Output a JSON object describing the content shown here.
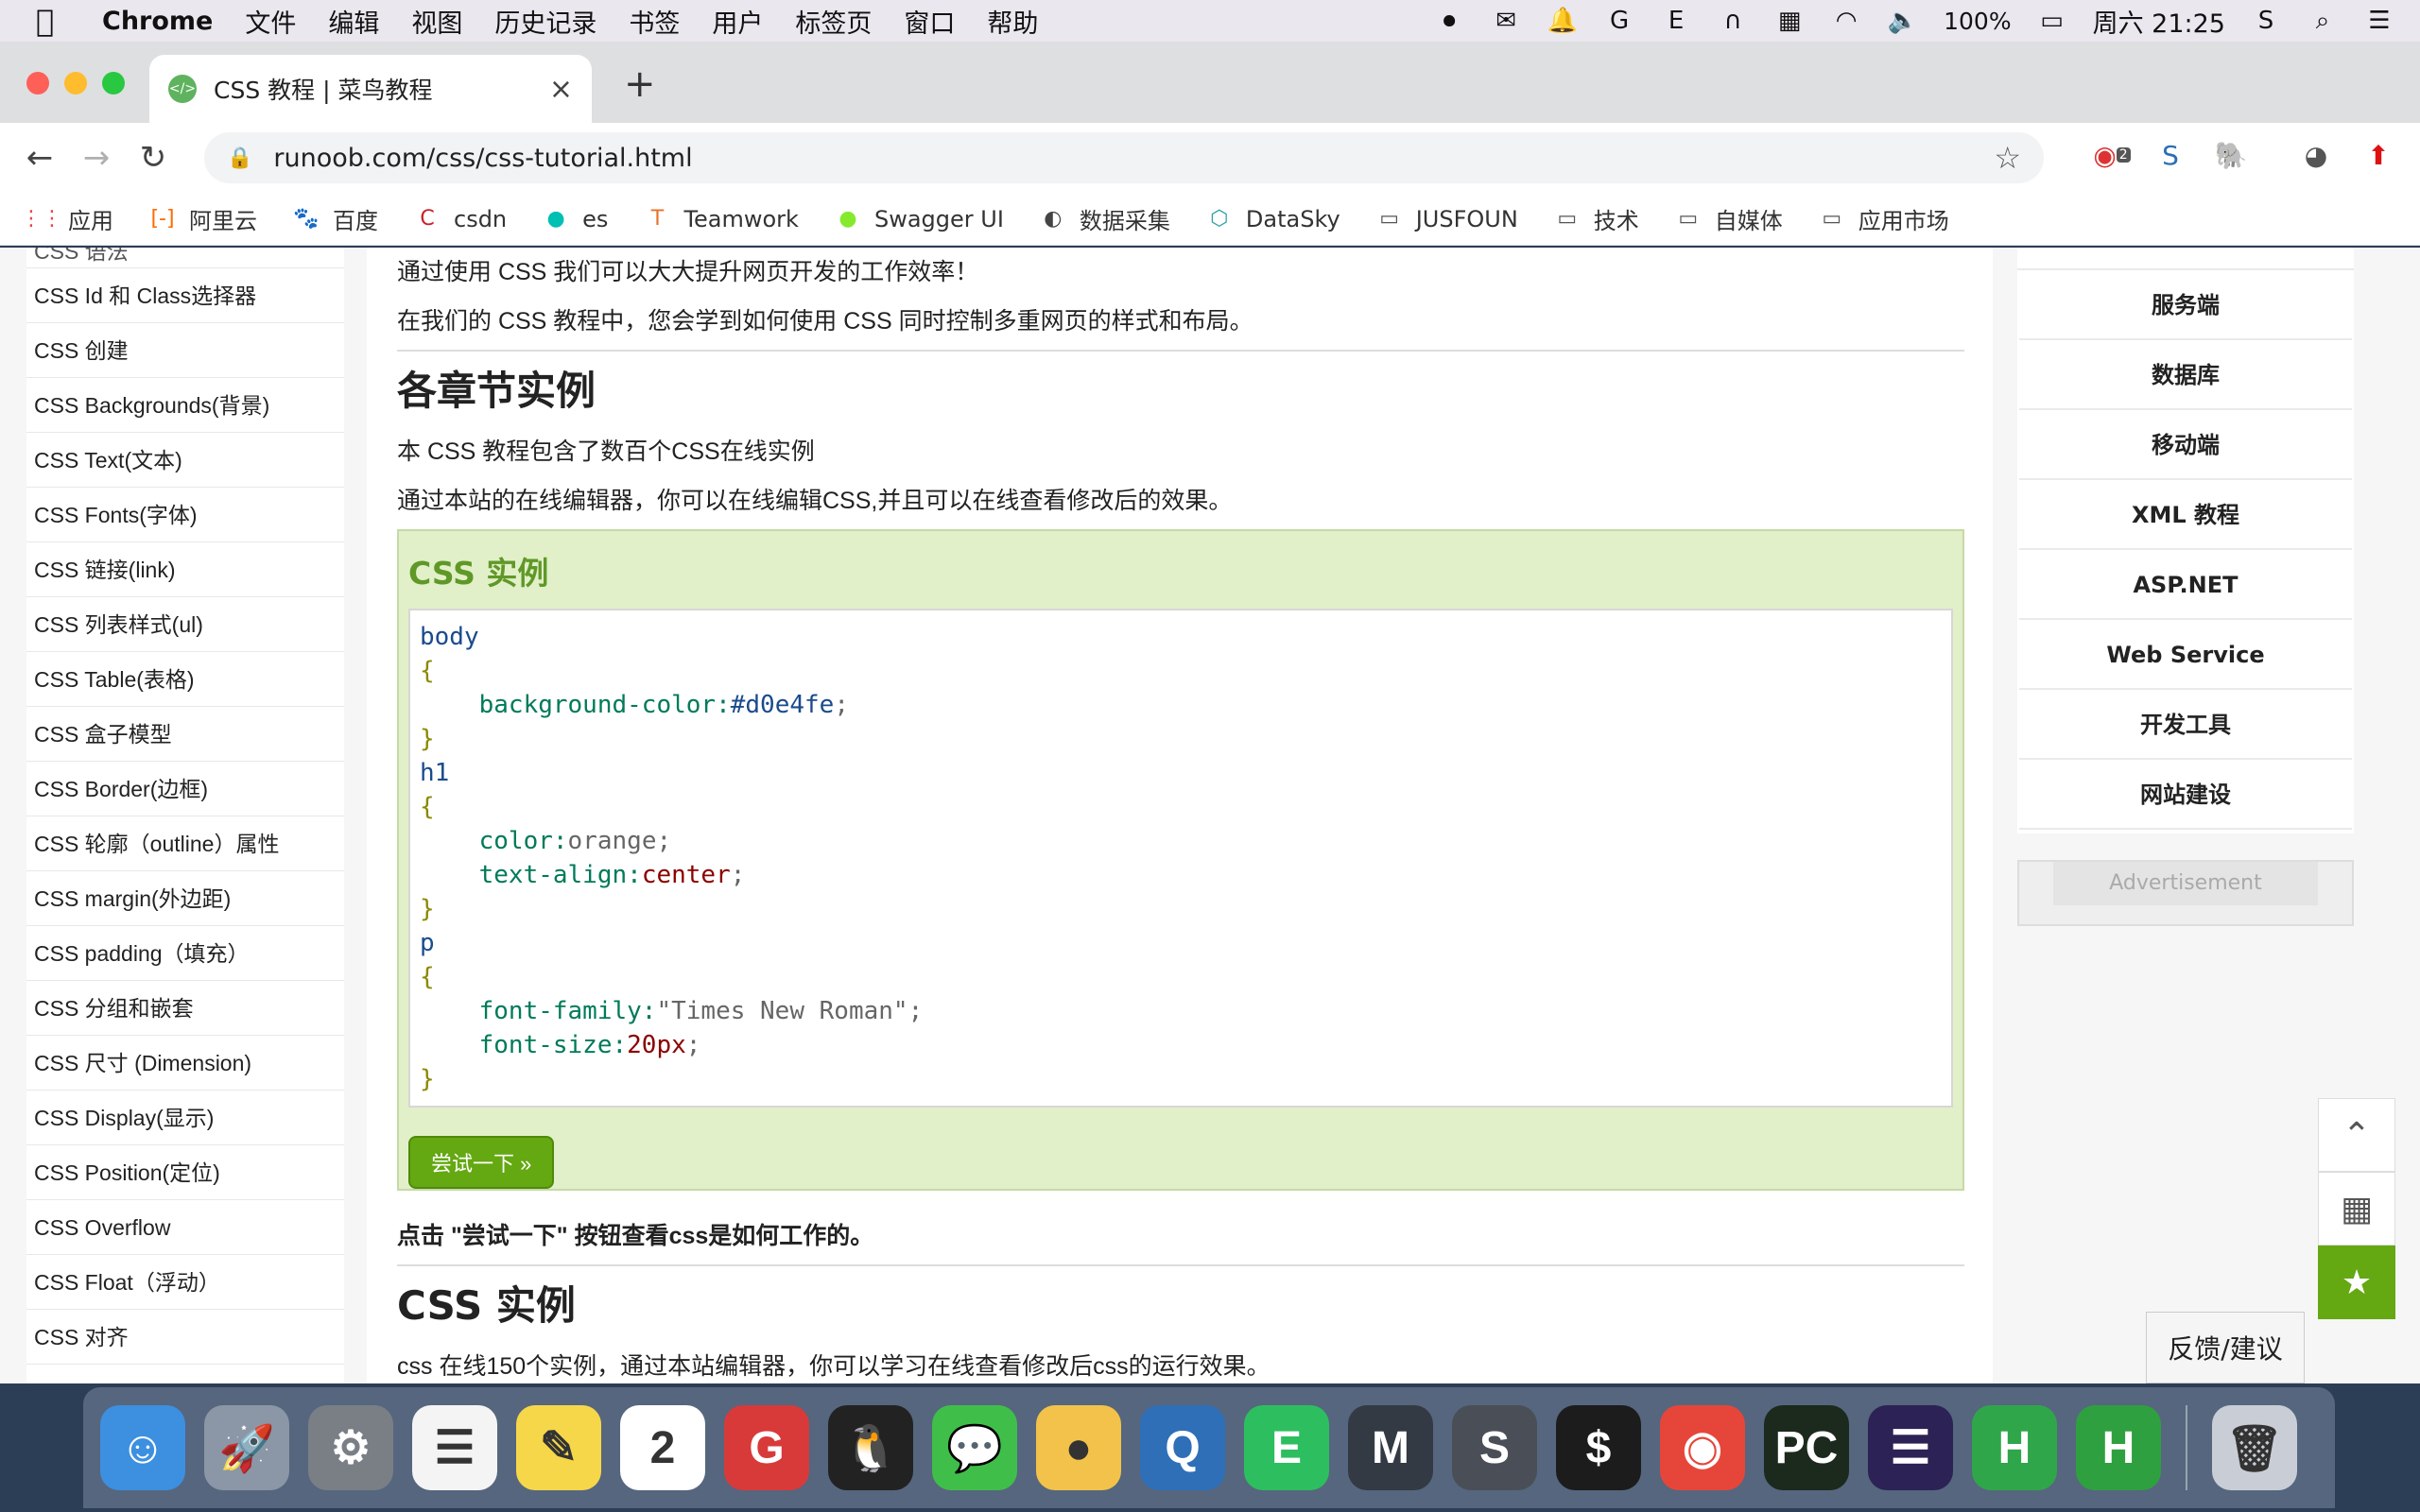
{
  "menubar": {
    "app": "Chrome",
    "items": [
      "文件",
      "编辑",
      "视图",
      "历史记录",
      "书签",
      "用户",
      "标签页",
      "窗口",
      "帮助"
    ],
    "battery": "100%",
    "datetime": "周六 21:25"
  },
  "tab": {
    "title": "CSS 教程 | 菜鸟教程"
  },
  "address": {
    "url": "runoob.com/css/css-tutorial.html"
  },
  "extensions": {
    "badge": "2"
  },
  "bookmarks": [
    {
      "label": "应用",
      "icon": "apps-grid-icon"
    },
    {
      "label": "阿里云",
      "icon": "aliyun-icon"
    },
    {
      "label": "百度",
      "icon": "baidu-paw-icon"
    },
    {
      "label": "csdn",
      "icon": "csdn-icon"
    },
    {
      "label": "es",
      "icon": "elastic-icon"
    },
    {
      "label": "Teamwork",
      "icon": "teamwork-icon"
    },
    {
      "label": "Swagger UI",
      "icon": "swagger-icon"
    },
    {
      "label": "数据采集",
      "icon": "globe-icon"
    },
    {
      "label": "DataSky",
      "icon": "cube-icon"
    },
    {
      "label": "JUSFOUN",
      "icon": "folder-icon"
    },
    {
      "label": "技术",
      "icon": "folder-icon"
    },
    {
      "label": "自媒体",
      "icon": "folder-icon"
    },
    {
      "label": "应用市场",
      "icon": "folder-icon"
    }
  ],
  "sidebar": {
    "partial_item": "CSS 语法",
    "items": [
      "CSS Id 和 Class选择器",
      "CSS 创建",
      "CSS Backgrounds(背景)",
      "CSS Text(文本)",
      "CSS Fonts(字体)",
      "CSS 链接(link)",
      "CSS 列表样式(ul)",
      "CSS Table(表格)",
      "CSS 盒子模型",
      "CSS Border(边框)",
      "CSS 轮廓（outline）属性",
      "CSS margin(外边距)",
      "CSS padding（填充）",
      "CSS 分组和嵌套",
      "CSS 尺寸 (Dimension)",
      "CSS Display(显示)",
      "CSS Position(定位)",
      "CSS Overflow",
      "CSS Float（浮动）",
      "CSS 对齐"
    ]
  },
  "content": {
    "intro1": "通过使用 CSS 我们可以大大提升网页开发的工作效率！",
    "intro2": "在我们的 CSS 教程中，您会学到如何使用 CSS 同时控制多重网页的样式和布局。",
    "section1_title": "各章节实例",
    "section1_p1": "本 CSS 教程包含了数百个CSS在线实例",
    "section1_p2": "通过本站的在线编辑器，你可以在线编辑CSS,并且可以在线查看修改后的效果。",
    "example_title": "CSS 实例",
    "try_button": "尝试一下 »",
    "note": "点击 \"尝试一下\" 按钮查看css是如何工作的。",
    "section2_title": "CSS 实例",
    "section2_p": "css 在线150个实例，通过本站编辑器，你可以学习在线查看修改后css的运行效果。"
  },
  "code": {
    "colors": {
      "selector": "#1a4b8c",
      "prop": "#007a5a",
      "value_num": "#8b0000",
      "string": "#666666",
      "brace": "#8a8a00"
    },
    "lines": [
      [
        {
          "t": "body",
          "c": "selector"
        }
      ],
      [
        {
          "t": "{",
          "c": "brace"
        }
      ],
      [
        {
          "t": "    background-color:",
          "c": "prop"
        },
        {
          "t": "#d0e4fe",
          "c": "selector"
        },
        {
          "t": ";",
          "c": "string"
        }
      ],
      [
        {
          "t": "}",
          "c": "brace"
        }
      ],
      [
        {
          "t": "h1",
          "c": "selector"
        }
      ],
      [
        {
          "t": "{",
          "c": "brace"
        }
      ],
      [
        {
          "t": "    color:",
          "c": "prop"
        },
        {
          "t": "orange",
          "c": "string"
        },
        {
          "t": ";",
          "c": "string"
        }
      ],
      [
        {
          "t": "    text-align:",
          "c": "prop"
        },
        {
          "t": "center",
          "c": "value_num"
        },
        {
          "t": ";",
          "c": "string"
        }
      ],
      [
        {
          "t": "}",
          "c": "brace"
        }
      ],
      [
        {
          "t": "p",
          "c": "selector"
        }
      ],
      [
        {
          "t": "{",
          "c": "brace"
        }
      ],
      [
        {
          "t": "    font-family:",
          "c": "prop"
        },
        {
          "t": "\"Times New Roman\"",
          "c": "string"
        },
        {
          "t": ";",
          "c": "string"
        }
      ],
      [
        {
          "t": "    font-size:",
          "c": "prop"
        },
        {
          "t": "20px",
          "c": "value_num"
        },
        {
          "t": ";",
          "c": "string"
        }
      ],
      [
        {
          "t": "}",
          "c": "brace"
        }
      ]
    ]
  },
  "rightnav": {
    "items": [
      "服务端",
      "数据库",
      "移动端",
      "XML 教程",
      "ASP.NET",
      "Web Service",
      "开发工具",
      "网站建设"
    ],
    "ad": "Advertisement"
  },
  "feedback": "反馈/建议",
  "dock": [
    {
      "name": "finder-icon",
      "glyph": "☺",
      "color": "#3d8fe0"
    },
    {
      "name": "launchpad-icon",
      "glyph": "🚀",
      "color": "#8b96a6"
    },
    {
      "name": "system-preferences-icon",
      "glyph": "⚙",
      "color": "#7a7f86"
    },
    {
      "name": "reminders-icon",
      "glyph": "☰",
      "color": "#f4f4f4"
    },
    {
      "name": "notes-icon",
      "glyph": "✎",
      "color": "#f6d74a"
    },
    {
      "name": "calendar-icon",
      "glyph": "2",
      "color": "#ffffff"
    },
    {
      "name": "git-client-icon",
      "glyph": "G",
      "color": "#d83a3a"
    },
    {
      "name": "qq-icon",
      "glyph": "🐧",
      "color": "#222222"
    },
    {
      "name": "wechat-icon",
      "glyph": "💬",
      "color": "#3fbf4a"
    },
    {
      "name": "note-app-icon",
      "glyph": "●",
      "color": "#f2c24a"
    },
    {
      "name": "quicktime-icon",
      "glyph": "Q",
      "color": "#2e6fb8"
    },
    {
      "name": "evernote-icon",
      "glyph": "E",
      "color": "#2dbe60"
    },
    {
      "name": "terminal-m-icon",
      "glyph": "M",
      "color": "#333a44"
    },
    {
      "name": "sublime-text-icon",
      "glyph": "S",
      "color": "#4a4f57"
    },
    {
      "name": "terminal-icon",
      "glyph": "$",
      "color": "#1c1c1c"
    },
    {
      "name": "chrome-icon",
      "glyph": "◉",
      "color": "#e6463a"
    },
    {
      "name": "pycharm-icon",
      "glyph": "PC",
      "color": "#1b2a1c"
    },
    {
      "name": "eclipse-icon",
      "glyph": "☰",
      "color": "#2c2255"
    },
    {
      "name": "hbuilder-icon",
      "glyph": "H",
      "color": "#30a64a"
    },
    {
      "name": "hbuilderx-icon",
      "glyph": "H",
      "color": "#2fa03f"
    },
    {
      "name": "trash-icon",
      "glyph": "🗑",
      "color": "#c9ced6"
    }
  ]
}
